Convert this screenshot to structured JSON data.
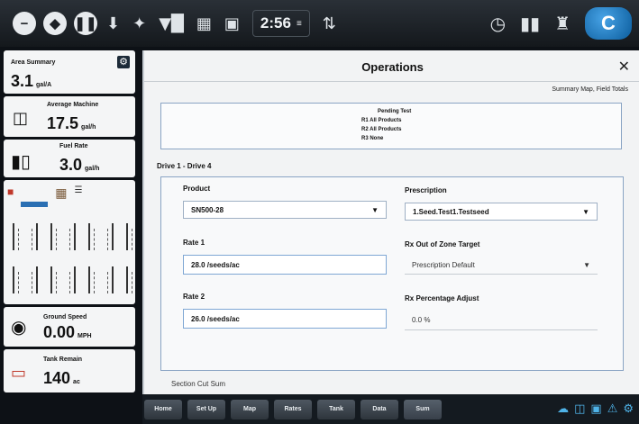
{
  "topbar": {
    "left_icons": [
      "minus-icon",
      "diamond-icon",
      "pause-icon"
    ],
    "status_icons": [
      "download-icon",
      "satellite-icon",
      "wifi-signal-icon",
      "grid-icon",
      "screen-icon"
    ],
    "clock": "2:56",
    "right_icons": [
      "gauge-icon",
      "implement-icon",
      "operator-icon"
    ],
    "home_label": "C"
  },
  "sidebar": {
    "tile1": {
      "label": "Area Summary",
      "value": "3.1",
      "unit": "gal/A"
    },
    "tile2": {
      "label": "Average Machine",
      "value": "17.5",
      "unit": "gal/h"
    },
    "tile3": {
      "label": "Fuel Rate",
      "value": "3.0",
      "unit": "gal/h"
    },
    "tile5": {
      "label": "Ground Speed",
      "value": "0.00",
      "unit": "MPH"
    },
    "tile6": {
      "label": "Tank Remain",
      "value": "140",
      "unit": "ac"
    }
  },
  "panel": {
    "title": "Operations",
    "summary_link": "Summary Map, Field Totals",
    "info_lines": [
      "Pending Test",
      "R1  All Products",
      "R2  All Products",
      "R3  None"
    ],
    "section_label": "Drive 1 - Drive 4",
    "product_label": "Product",
    "product_value": "SN500-28",
    "prescription_label": "Prescription",
    "prescription_value": "1.Seed.Test1.Testseed",
    "rate1_label": "Rate 1",
    "rate1_value": "28.0 /seeds/ac",
    "rate2_label": "Rate 2",
    "rate2_value": "26.0 /seeds/ac",
    "out_of_zone_label": "Rx Out of Zone Target",
    "out_of_zone_value": "Prescription Default",
    "rx_percent_label": "Rx Percentage Adjust",
    "rx_percent_value": "0.0 %",
    "cutoff_text": "Section Cut Sum"
  },
  "bottombar": {
    "tabs": [
      "Home",
      "Set Up",
      "Map",
      "Rates",
      "Tank",
      "Data",
      "Sum"
    ],
    "tray_icons": [
      "cloud-icon",
      "folder-icon",
      "camera-icon",
      "alert-icon",
      "gear-icon"
    ]
  }
}
